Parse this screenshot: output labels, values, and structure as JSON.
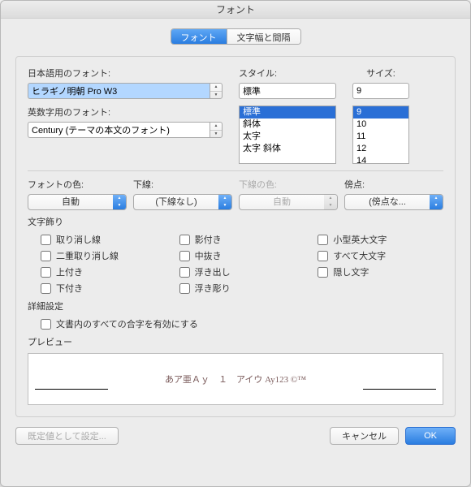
{
  "window": {
    "title": "フォント"
  },
  "tabs": {
    "font": "フォント",
    "spacing": "文字幅と間隔"
  },
  "labels": {
    "jp_font": "日本語用のフォント:",
    "en_font": "英数字用のフォント:",
    "style": "スタイル:",
    "size": "サイズ:",
    "font_color": "フォントの色:",
    "underline": "下線:",
    "underline_color": "下線の色:",
    "emphasis": "傍点:",
    "effects": "文字飾り",
    "advanced": "詳細設定",
    "preview": "プレビュー"
  },
  "values": {
    "jp_font": "ヒラギノ明朝 Pro W3",
    "en_font": "Century (テーマの本文のフォント)",
    "style_field": "標準",
    "size_field": "9"
  },
  "style_options": [
    "標準",
    "斜体",
    "太字",
    "太字 斜体"
  ],
  "size_options": [
    "9",
    "10",
    "11",
    "12",
    "14"
  ],
  "dropdowns": {
    "font_color": "自動",
    "underline": "(下線なし)",
    "underline_color": "自動",
    "emphasis": "(傍点な..."
  },
  "effects": {
    "col1": [
      "取り消し線",
      "二重取り消し線",
      "上付き",
      "下付き"
    ],
    "col2": [
      "影付き",
      "中抜き",
      "浮き出し",
      "浮き彫り"
    ],
    "col3": [
      "小型英大文字",
      "すべて大文字",
      "隠し文字"
    ]
  },
  "advanced_check": "文書内のすべての合字を有効にする",
  "preview_text": "あア亜Ａｙ　１　アイウ Ay123 ©™",
  "buttons": {
    "default": "既定値として設定...",
    "cancel": "キャンセル",
    "ok": "OK"
  }
}
